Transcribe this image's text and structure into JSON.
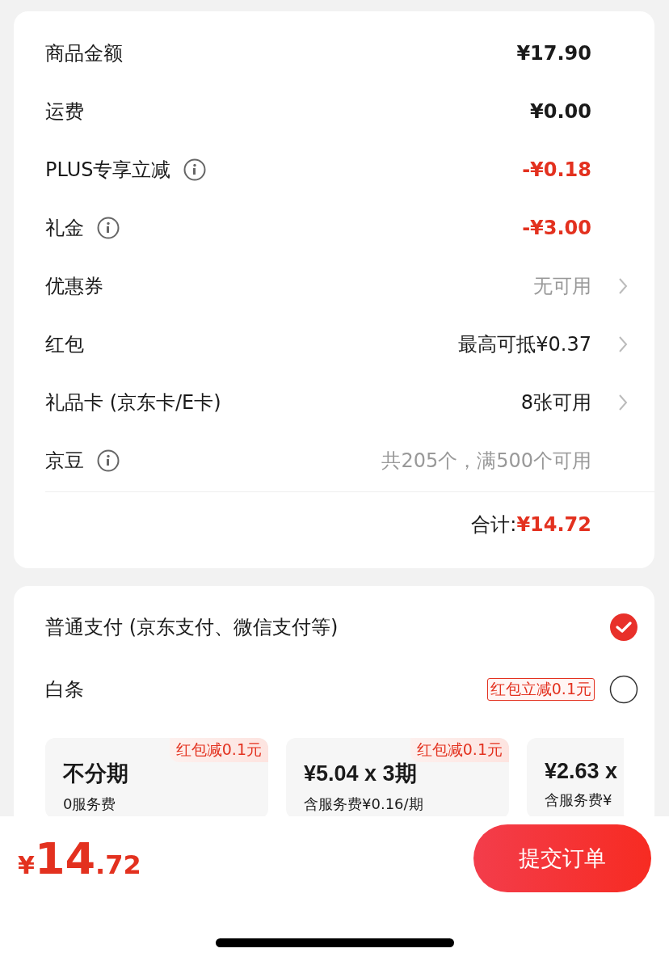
{
  "summary": {
    "rows": [
      {
        "label": "商品金额",
        "info": false,
        "value": "¥17.90",
        "kind": "amount",
        "chevron": false
      },
      {
        "label": "运费",
        "info": false,
        "value": "¥0.00",
        "kind": "amount",
        "chevron": false
      },
      {
        "label": "PLUS专享立减",
        "info": true,
        "value": "-¥0.18",
        "kind": "discount",
        "chevron": false
      },
      {
        "label": "礼金",
        "info": true,
        "value": "-¥3.00",
        "kind": "discount",
        "chevron": false
      },
      {
        "label": "优惠券",
        "info": false,
        "value": "无可用",
        "kind": "hint",
        "chevron": true
      },
      {
        "label": "红包",
        "info": false,
        "value": "最高可抵¥0.37",
        "kind": "text",
        "chevron": true
      },
      {
        "label": "礼品卡 (京东卡/E卡)",
        "info": false,
        "value": "8张可用",
        "kind": "text",
        "chevron": true
      },
      {
        "label": "京豆",
        "info": true,
        "value": "共205个，满500个可用",
        "kind": "hint",
        "chevron": false
      }
    ],
    "total_label": "合计:",
    "total_value": "¥14.72"
  },
  "payment": {
    "methods": [
      {
        "label": "普通支付 (京东支付、微信支付等)",
        "selected": true
      },
      {
        "label": "白条",
        "tag": "红包立减0.1元",
        "selected": false
      }
    ],
    "plans": [
      {
        "tag": "红包减0.1元",
        "title": "不分期",
        "note": "0服务费"
      },
      {
        "tag": "红包减0.1元",
        "title": "¥5.04 x 3期",
        "note": "含服务费¥0.16/期"
      },
      {
        "title": "¥2.63 x",
        "note": "含服务费¥"
      }
    ]
  },
  "footer": {
    "price_currency": "¥",
    "price_integer": "14",
    "price_decimal": ".72",
    "submit": "提交订单"
  }
}
